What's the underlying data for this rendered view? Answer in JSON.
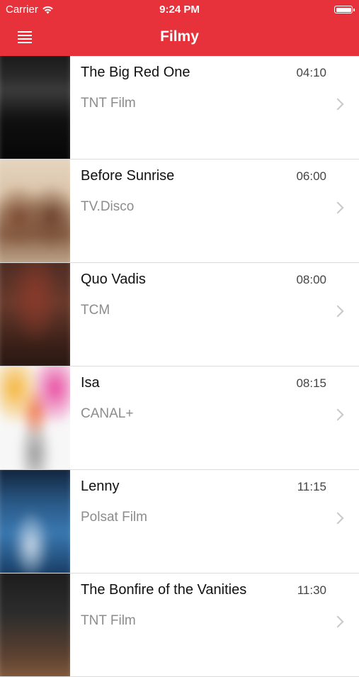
{
  "status_bar": {
    "carrier": "Carrier",
    "time": "9:24 PM"
  },
  "nav": {
    "title": "Filmy",
    "menu_icon": "hamburger-menu-icon"
  },
  "colors": {
    "accent": "#e8323b"
  },
  "movies": [
    {
      "title": "The Big Red One",
      "time": "04:10",
      "channel": "TNT Film"
    },
    {
      "title": "Before Sunrise",
      "time": "06:00",
      "channel": "TV.Disco"
    },
    {
      "title": "Quo Vadis",
      "time": "08:00",
      "channel": "TCM"
    },
    {
      "title": "Isa",
      "time": "08:15",
      "channel": "CANAL+"
    },
    {
      "title": "Lenny",
      "time": "11:15",
      "channel": "Polsat Film"
    },
    {
      "title": "The Bonfire of the Vanities",
      "time": "11:30",
      "channel": "TNT Film"
    }
  ]
}
